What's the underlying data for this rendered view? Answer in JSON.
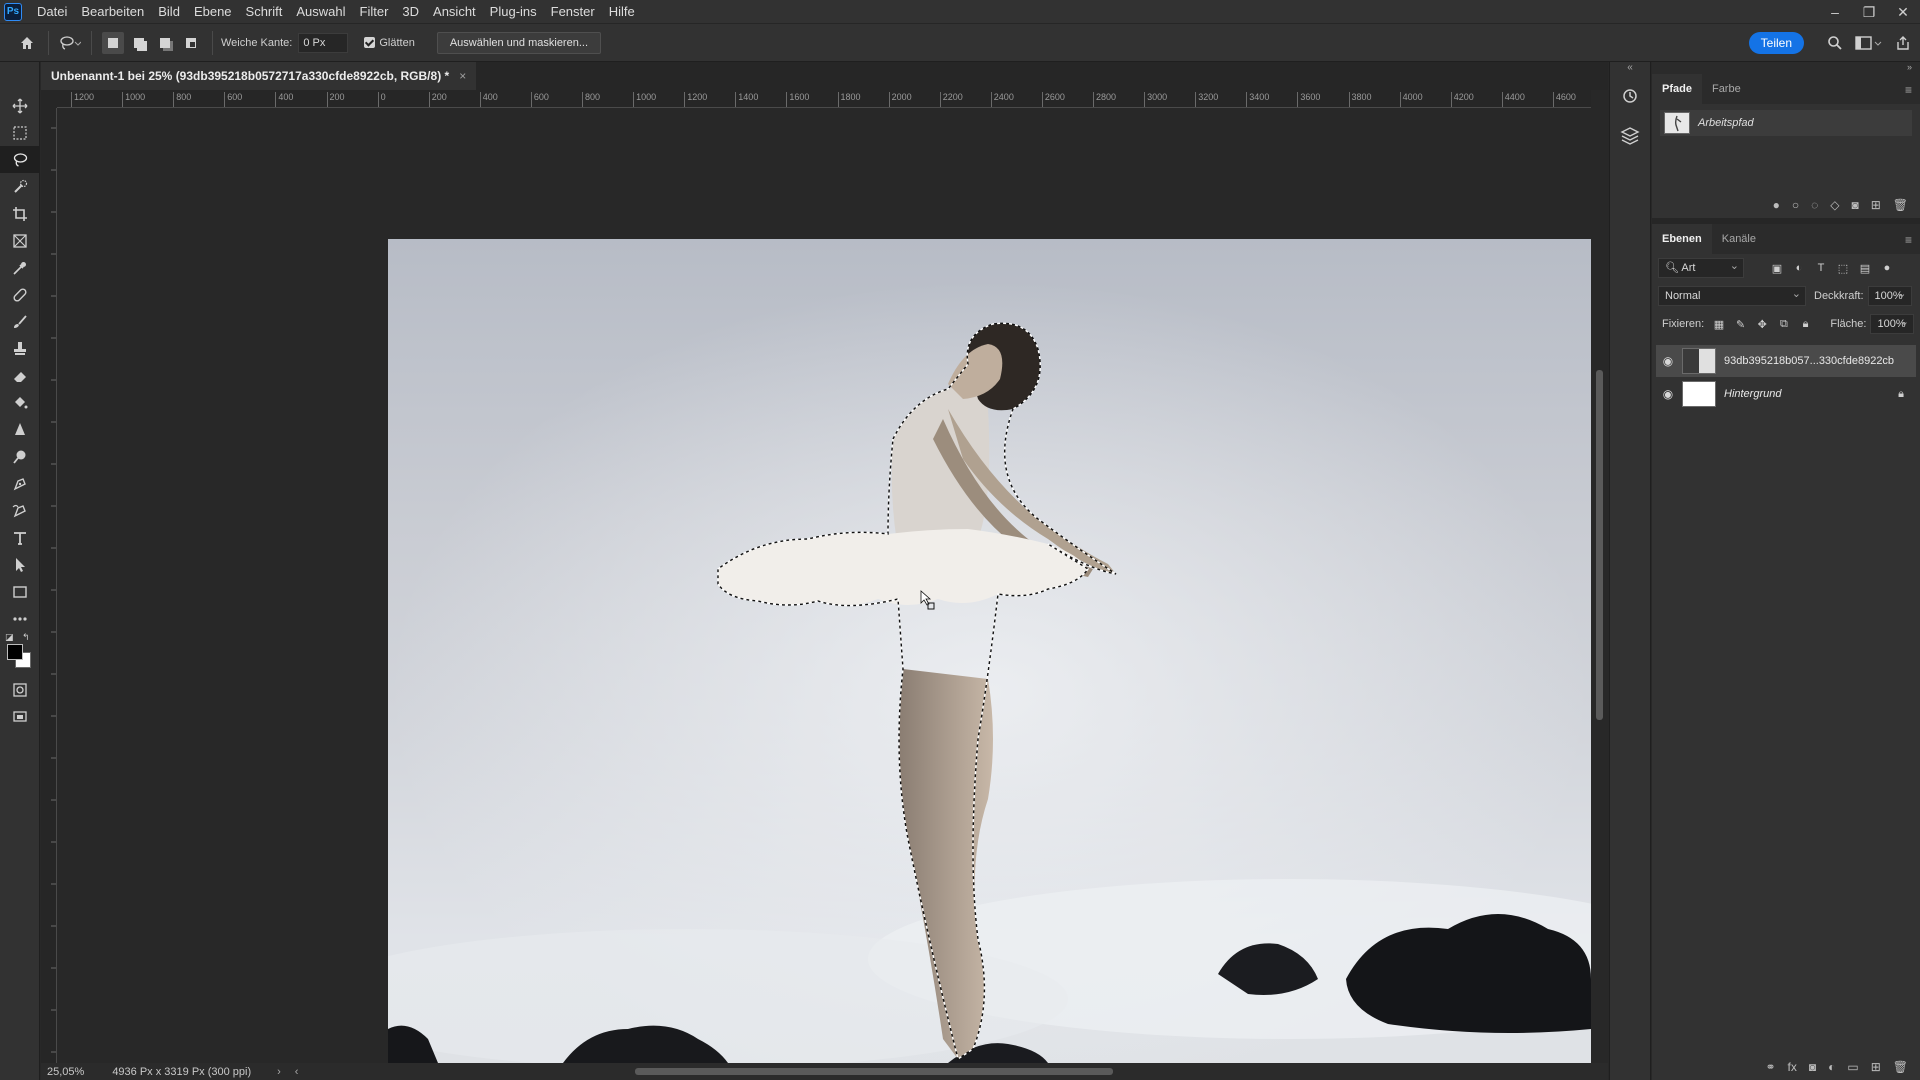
{
  "app": {
    "logo": "Ps"
  },
  "menu": [
    "Datei",
    "Bearbeiten",
    "Bild",
    "Ebene",
    "Schrift",
    "Auswahl",
    "Filter",
    "3D",
    "Ansicht",
    "Plug-ins",
    "Fenster",
    "Hilfe"
  ],
  "options": {
    "feather_label": "Weiche Kante:",
    "feather_value": "0 Px",
    "antialias_label": "Glätten",
    "antialias_checked": true,
    "select_mask_label": "Auswählen und maskieren...",
    "share_label": "Teilen"
  },
  "document": {
    "tab_title": "Unbenannt-1 bei 25% (93db395218b0572717a330cfde8922cb, RGB/8) *",
    "zoom": "25,05%",
    "dimensions": "4936 Px x 3319 Px (300 ppi)"
  },
  "ruler_h": [
    "1200",
    "1000",
    "800",
    "600",
    "400",
    "200",
    "0",
    "200",
    "400",
    "600",
    "800",
    "1000",
    "1200",
    "1400",
    "1600",
    "1800",
    "2000",
    "2200",
    "2400",
    "2600",
    "2800",
    "3000",
    "3200",
    "3400",
    "3600",
    "3800",
    "4000",
    "4200",
    "4400",
    "4600"
  ],
  "paths_panel": {
    "tabs": [
      "Pfade",
      "Farbe"
    ],
    "active_tab": "Pfade",
    "path_name": "Arbeitspfad"
  },
  "layers_panel": {
    "tabs": [
      "Ebenen",
      "Kanäle"
    ],
    "active_tab": "Ebenen",
    "filter_kind": "Art",
    "blend_mode": "Normal",
    "opacity_label": "Deckkraft:",
    "opacity_value": "100%",
    "lock_label": "Fixieren:",
    "fill_label": "Fläche:",
    "fill_value": "100%",
    "layers": [
      {
        "name": "93db395218b057...330cfde8922cb",
        "visible": true,
        "selected": true,
        "italic": false
      },
      {
        "name": "Hintergrund",
        "visible": true,
        "selected": false,
        "italic": true,
        "locked": true
      }
    ]
  },
  "colors": {
    "accent": "#1473e6",
    "foreground": "#000000",
    "background": "#ffffff"
  }
}
